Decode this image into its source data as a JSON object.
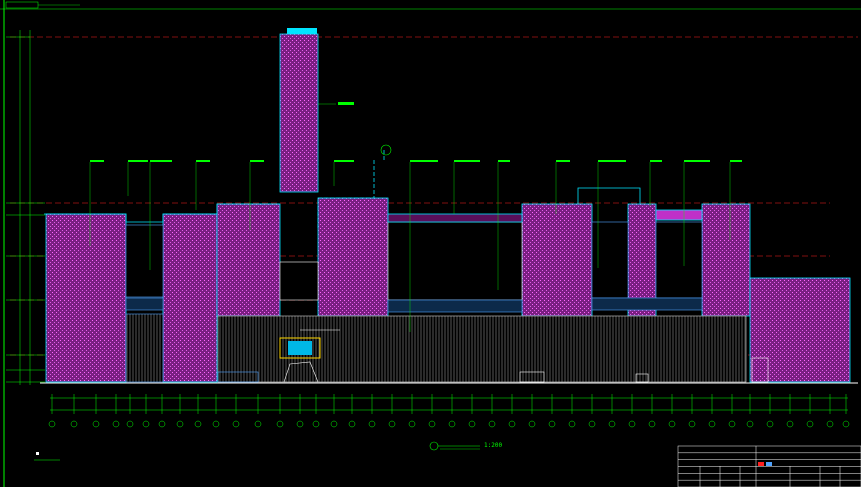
{
  "canvas": {
    "background": "#000000",
    "colors": {
      "frame": "#00ff00",
      "wall": "#a020a0",
      "outline": "#00e5ff",
      "glazing": "#4fa3ff",
      "level_line": "#ff2020",
      "dim": "#00ff00",
      "white": "#ffffff",
      "accent_yellow": "#ffd800"
    }
  },
  "drawing": {
    "title": "",
    "scale": "1:200",
    "top_left_note": "",
    "bottom_left_note": "",
    "title_block_rows": 6
  }
}
